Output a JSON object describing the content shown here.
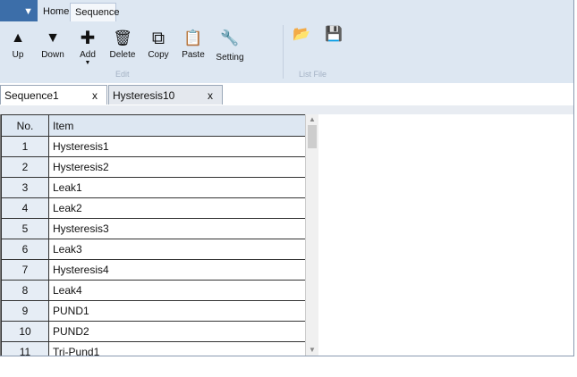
{
  "ribbon": {
    "app_menu_glyph": "▼",
    "tabs": [
      "Home",
      "Sequence"
    ],
    "active_tab": "Sequence",
    "buttons": [
      {
        "label": "Up",
        "icon": "up-arrow-icon",
        "glyph": "▲"
      },
      {
        "label": "Down",
        "icon": "down-arrow-icon",
        "glyph": "▼"
      },
      {
        "label": "Add",
        "icon": "plus-icon",
        "glyph": "✚"
      },
      {
        "label": "Delete",
        "icon": "trash-icon",
        "glyph": "🗑"
      },
      {
        "label": "Copy",
        "icon": "copy-icon",
        "glyph": "⧉"
      },
      {
        "label": "Paste",
        "icon": "paste-icon",
        "glyph": "📋"
      },
      {
        "label": "Setting",
        "icon": "wrench-icon",
        "glyph": "🔧"
      }
    ],
    "file_buttons": [
      {
        "icon": "open-folder-icon",
        "glyph": "📂"
      },
      {
        "icon": "save-icon",
        "glyph": "💾"
      }
    ],
    "group_labels": {
      "edit": "Edit",
      "list_file": "List File"
    }
  },
  "doc_tabs": [
    {
      "label": "Sequence1",
      "close": "x"
    },
    {
      "label": "Hysteresis10",
      "close": "x"
    }
  ],
  "table": {
    "headers": [
      "No.",
      "Item"
    ],
    "rows": [
      [
        "1",
        "Hysteresis1"
      ],
      [
        "2",
        "Hysteresis2"
      ],
      [
        "3",
        "Leak1"
      ],
      [
        "4",
        "Leak2"
      ],
      [
        "5",
        "Hysteresis3"
      ],
      [
        "6",
        "Leak3"
      ],
      [
        "7",
        "Hysteresis4"
      ],
      [
        "8",
        "Leak4"
      ],
      [
        "9",
        "PUND1"
      ],
      [
        "10",
        "PUND2"
      ],
      [
        "11",
        "Tri-Pund1"
      ]
    ]
  },
  "colors": {
    "ribbon_bg": "#dde7f2",
    "app_menu": "#3c6ea9",
    "grid_header": "#dde7f2"
  }
}
